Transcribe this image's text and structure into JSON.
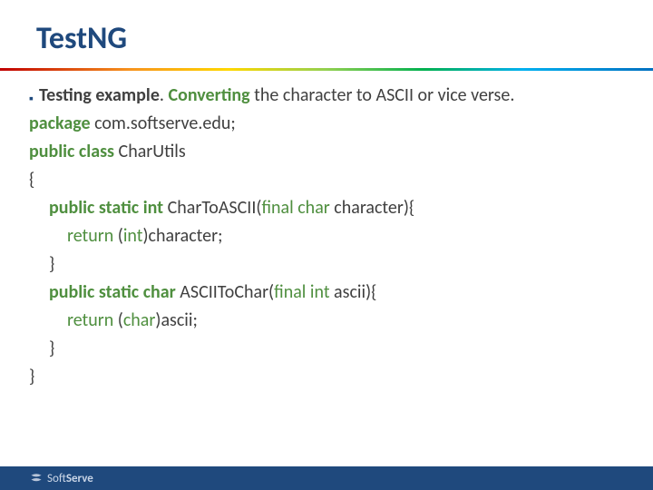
{
  "title": "TestNG",
  "bullet_label": "Testing example",
  "bullet_sep": ". ",
  "bullet_action": "Converting",
  "bullet_rest": " the character to ASCII or vice verse.",
  "code": {
    "l1_kw": "package",
    "l1_rest": " com.softserve.edu;",
    "l2_kw": "public class",
    "l2_rest": " CharUtils",
    "l3": "{",
    "l4_kw": "public static int",
    "l4_name": " CharToASCII(",
    "l4_param_kw": "final char",
    "l4_param_rest": " character){",
    "l5_kw": "return",
    "l5_a": " (",
    "l5_cast": "int",
    "l5_b": ")character;",
    "l6": "}",
    "l7_kw": "public static char",
    "l7_name": " ASCIIToChar(",
    "l7_param_kw": "final int",
    "l7_param_rest": " ascii){",
    "l8_kw": "return",
    "l8_a": " (",
    "l8_cast": "char",
    "l8_b": ")ascii;",
    "l9": "}",
    "l10": "}"
  },
  "footer": {
    "brand_a": "Soft",
    "brand_b": "Serve"
  }
}
